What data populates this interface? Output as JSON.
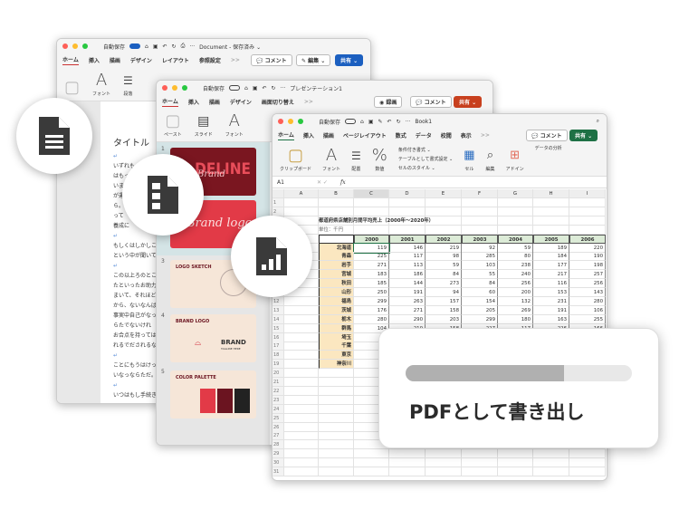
{
  "word": {
    "autosave": "自動保存",
    "title": "Document - 保存済み ⌄",
    "tabs": [
      "ホーム",
      "挿入",
      "描画",
      "デザイン",
      "レイアウト",
      "参照設定"
    ],
    "more": ">>",
    "comment": "コメント",
    "edit": "編集 ⌄",
    "share": "共有 ⌄",
    "ribbon": [
      "フォント",
      "段落"
    ],
    "doc_title": "タイトル",
    "lines": [
      "いずれも",
      "はもっ",
      "いま",
      "が運",
      "ら。",
      "って",
      "養成に",
      "もしくはしかしこ",
      "という中が聞いて",
      "この以上ろのとこ",
      "たといったお助力",
      "まいて、それほど",
      "から、ないなんば",
      "事実中自己がなっ",
      "らたでないけれ",
      "お合点を持っては",
      "れるでだされるな",
      "ことにもうはけっ",
      "いなっならただ。",
      "いつはもし手続き"
    ]
  },
  "ppt": {
    "autosave": "自動保存",
    "title": "プレゼンテーション1",
    "tabs": [
      "ホーム",
      "挿入",
      "描画",
      "デザイン",
      "画面切り替え"
    ],
    "more": ">>",
    "record": "録画",
    "comment": "コメント",
    "share": "共有 ⌄",
    "ribbon": [
      "ペースト",
      "スライド",
      "フォント"
    ],
    "slides": [
      {
        "num": "1",
        "title": "DELINE",
        "script": "Brand"
      },
      {
        "num": "2",
        "script": "Brand logo"
      },
      {
        "num": "3",
        "title": "LOGO SKETCH"
      },
      {
        "num": "4",
        "title": "BRAND LOGO",
        "brand": "BRAND",
        "tagline": "TAGLINE HERE"
      },
      {
        "num": "5",
        "title": "COLOR PALETTE"
      }
    ]
  },
  "excel": {
    "autosave": "自動保存",
    "title": "Book1",
    "tabs": [
      "ホーム",
      "挿入",
      "描画",
      "ページレイアウト",
      "数式",
      "データ",
      "校閲",
      "表示"
    ],
    "more": ">>",
    "comment": "コメント",
    "share": "共有 ⌄",
    "ribbon": [
      "クリップボード",
      "フォント",
      "配置",
      "数値",
      "セル",
      "編集",
      "アドイン"
    ],
    "styles": [
      "条件付き書式 ⌄",
      "テーブルとして書式設定 ⌄",
      "セルのスタイル ⌄"
    ],
    "analyze": "データの分析",
    "name_box": "A1",
    "fx": "fx",
    "columns": [
      "A",
      "B",
      "C",
      "D",
      "E",
      "F",
      "G",
      "H",
      "I"
    ],
    "sheet_title": "都道府県店舗別月間平均売上（2000年～2020年）",
    "unit": "単位：千円",
    "years": [
      "2000",
      "2001",
      "2002",
      "2003",
      "2004",
      "2005",
      "2006"
    ],
    "rows": [
      {
        "name": "北海道",
        "values": [
          "119",
          "146",
          "219",
          "92",
          "59",
          "189",
          "220"
        ]
      },
      {
        "name": "青森",
        "values": [
          "225",
          "117",
          "98",
          "285",
          "80",
          "184",
          "190"
        ]
      },
      {
        "name": "岩手",
        "values": [
          "271",
          "113",
          "59",
          "103",
          "238",
          "177",
          "198"
        ]
      },
      {
        "name": "宮城",
        "values": [
          "183",
          "186",
          "84",
          "55",
          "240",
          "217",
          "257"
        ]
      },
      {
        "name": "秋田",
        "values": [
          "185",
          "144",
          "273",
          "84",
          "256",
          "116",
          "256"
        ]
      },
      {
        "name": "山形",
        "values": [
          "250",
          "191",
          "94",
          "60",
          "200",
          "153",
          "143"
        ]
      },
      {
        "name": "福島",
        "values": [
          "299",
          "263",
          "157",
          "154",
          "132",
          "231",
          "280"
        ]
      },
      {
        "name": "茨城",
        "values": [
          "176",
          "271",
          "158",
          "205",
          "269",
          "191",
          "106"
        ]
      },
      {
        "name": "栃木",
        "values": [
          "280",
          "290",
          "203",
          "299",
          "180",
          "163",
          "255"
        ]
      },
      {
        "name": "群馬",
        "values": [
          "104",
          "210",
          "158",
          "227",
          "117",
          "226",
          "166"
        ]
      },
      {
        "name": "埼玉",
        "values": []
      },
      {
        "name": "千葉",
        "values": []
      },
      {
        "name": "東京",
        "values": []
      },
      {
        "name": "神奈川",
        "values": []
      }
    ]
  },
  "dialog": {
    "label": "PDFとして書き出し",
    "progress_percent": 70
  },
  "colors": {
    "word": "#1b5fc0",
    "ppt": "#c8401e",
    "excel": "#1e7145",
    "icon": "#3a3a3a"
  }
}
